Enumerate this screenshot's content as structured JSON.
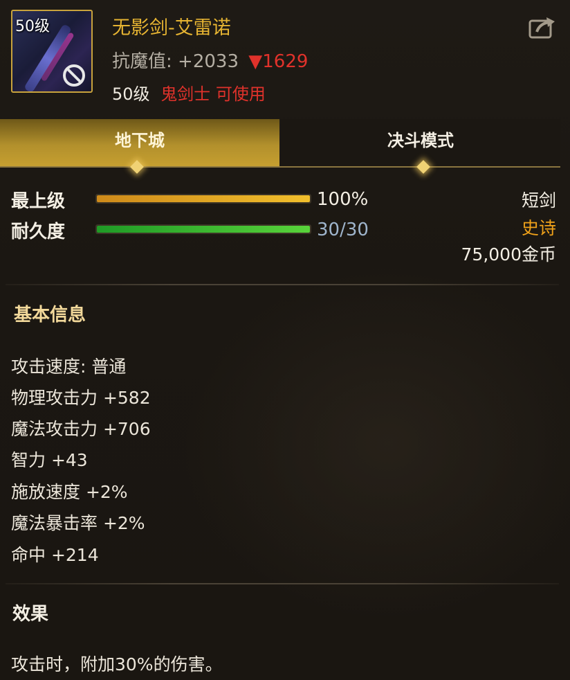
{
  "item": {
    "level_badge": "50级",
    "name": "无影剑-艾雷诺",
    "resist_label": "抗魔值:",
    "resist_value": "+2033",
    "resist_diff": "▼1629",
    "req_level": "50级",
    "req_class": "鬼剑士 可使用"
  },
  "tabs": [
    {
      "label": "地下城",
      "active": true
    },
    {
      "label": "决斗模式",
      "active": false
    }
  ],
  "bars": {
    "grade_label": "最上级",
    "grade_value": "100%",
    "grade_fill_percent": 100,
    "durability_label": "耐久度",
    "durability_value": "30/30",
    "durability_fill_percent": 100
  },
  "meta": {
    "type": "短剑",
    "rarity": "史诗",
    "price": "75,000金币"
  },
  "basic_info": {
    "title": "基本信息",
    "attributes": [
      "攻击速度: 普通",
      "物理攻击力 +582",
      "魔法攻击力 +706",
      "智力 +43",
      "施放速度 +2%",
      "魔法暴击率 +2%",
      "命中 +214"
    ]
  },
  "effect": {
    "title": "效果",
    "text": "攻击时，附加30%的伤害。"
  },
  "colors": {
    "gold": "#e6b432",
    "red": "#e0322b",
    "orange_text": "#f0a21a",
    "section_gold": "#f2d89a",
    "durability_text": "#9fb5cc"
  },
  "icons": [
    "no-use-icon",
    "share-icon",
    "tab-diamond-icon"
  ]
}
